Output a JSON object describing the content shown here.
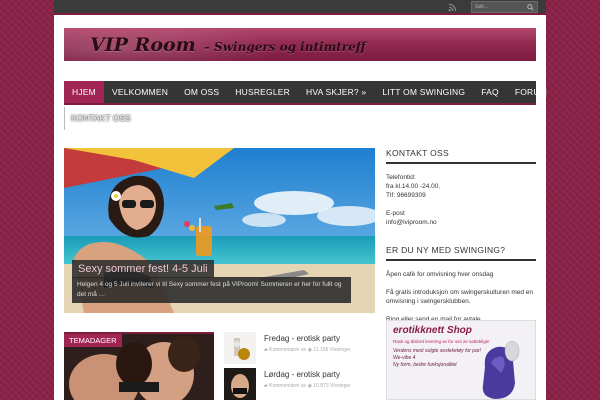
{
  "search": {
    "placeholder": "Søk..."
  },
  "header": {
    "logo_main": "VIP Room",
    "logo_sub": "– Swingers og intimtreff"
  },
  "nav": {
    "items": [
      "HJEM",
      "VELKOMMEN",
      "OM OSS",
      "HUSREGLER",
      "HVA SKJER? »",
      "LITT OM SWINGING",
      "FAQ",
      "FORUM"
    ],
    "row2": "KONTAKT OSS"
  },
  "featured": {
    "title": "Sexy sommer fest! 4-5 Juli",
    "excerpt": "Helgen 4 og 5 Juli inviterer vi til Sexy sommer fest på VIProom! Sommeren er her for fullt og det må …"
  },
  "sidebar": {
    "contact": {
      "heading": "KONTAKT OSS",
      "phone_label": "Telefontid:",
      "hours": "fra kl.14.00 -24.00.",
      "phone": "Tlf: 96699309",
      "email_label": "E-post",
      "email": "info@iviproom.no"
    },
    "newbie": {
      "heading": "ER DU NY MED SWINGING?",
      "line1": "Åpen café for omvisning hver onsdag",
      "line2": "Få gratis introduksjon om swingerskulturen med en omvisning i swingersklubben.",
      "line3": "Ring eller send en mail for avtale."
    }
  },
  "shop": {
    "brand": "erotikknett Shop",
    "sub": "Rask og diskret levering av for oss av satteblige!",
    "line1": "Verdens mest solgte sexleketøy for par!",
    "line2": "We-vibe 4",
    "line3": "Ny form, bedre funksjonalitet",
    "line4": ""
  },
  "tema": {
    "label": "TEMADAGER"
  },
  "posts": [
    {
      "title": "Fredag - erotisk party",
      "comments": "Kommentarer av",
      "views": "11.165 Visninger"
    },
    {
      "title": "Lørdag - erotisk party",
      "comments": "Kommentarer av",
      "views": "10.873 Visninger"
    }
  ],
  "colors": {
    "accent": "#a02554",
    "background": "#8a2248",
    "nav": "#353535"
  }
}
